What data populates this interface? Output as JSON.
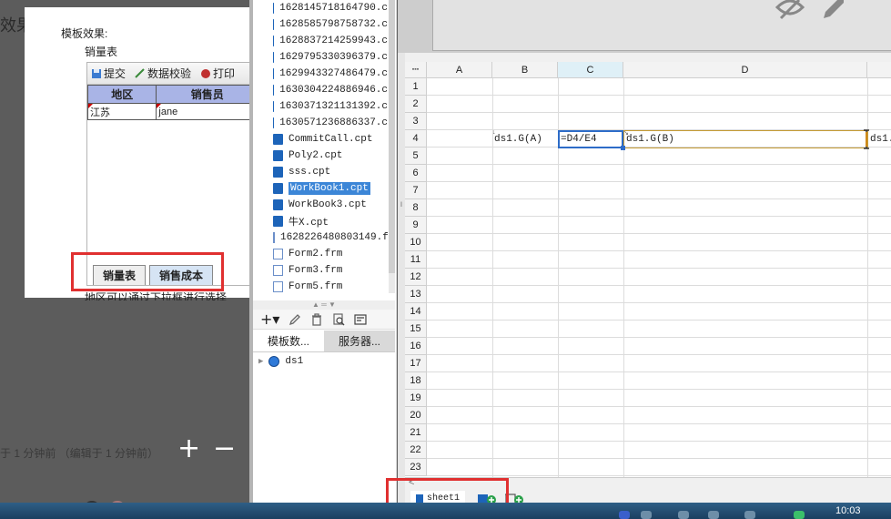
{
  "background": {
    "title_fragment": "效果",
    "status_text": "于 1 分钟前 （编辑于 1 分钟前）",
    "zoom_in": "+",
    "zoom_out": "−",
    "fragment_line": "地区可以通过下拉框进行选择"
  },
  "preview": {
    "caption": "模板效果:",
    "report_title": "销量表",
    "toolbar": {
      "submit_label": "提交",
      "validate_label": "数据校验",
      "print_label": "打印"
    },
    "table": {
      "headers": [
        "地区",
        "销售员"
      ],
      "rows": [
        [
          "江苏",
          "jane"
        ]
      ]
    },
    "sheet_tabs": [
      "销量表",
      "销售成本"
    ]
  },
  "designer": {
    "files": [
      {
        "name": "1628145718164790.c",
        "type": "cpt",
        "selected": false
      },
      {
        "name": "1628585798758732.c",
        "type": "cpt",
        "selected": false
      },
      {
        "name": "1628837214259943.c",
        "type": "cpt",
        "selected": false
      },
      {
        "name": "1629795330396379.c",
        "type": "cpt",
        "selected": false
      },
      {
        "name": "1629943327486479.c",
        "type": "cpt",
        "selected": false
      },
      {
        "name": "1630304224886946.c",
        "type": "cpt",
        "selected": false
      },
      {
        "name": "1630371321131392.c",
        "type": "cpt",
        "selected": false
      },
      {
        "name": "1630571236886337.c",
        "type": "cpt",
        "selected": false
      },
      {
        "name": "CommitCall.cpt",
        "type": "cpt",
        "selected": false
      },
      {
        "name": "Poly2.cpt",
        "type": "cpt",
        "selected": false
      },
      {
        "name": "sss.cpt",
        "type": "cpt",
        "selected": false
      },
      {
        "name": "WorkBook1.cpt",
        "type": "cpt",
        "selected": true
      },
      {
        "name": "WorkBook3.cpt",
        "type": "cpt",
        "selected": false
      },
      {
        "name": "牛X.cpt",
        "type": "cpt",
        "selected": false
      },
      {
        "name": "1628226480803149.f",
        "type": "frm",
        "selected": false
      },
      {
        "name": "Form2.frm",
        "type": "frm",
        "selected": false
      },
      {
        "name": "Form3.frm",
        "type": "frm",
        "selected": false
      },
      {
        "name": "Form5.frm",
        "type": "frm",
        "selected": false
      }
    ],
    "panel_tabs": [
      "模板数...",
      "服务器..."
    ],
    "dataset": "ds1",
    "add_label": "+▾"
  },
  "grid": {
    "columns": [
      "A",
      "B",
      "C",
      "D"
    ],
    "rows": [
      "1",
      "2",
      "3",
      "4",
      "5",
      "6",
      "7",
      "8",
      "9",
      "10",
      "11",
      "12",
      "13",
      "14",
      "15",
      "16",
      "17",
      "18",
      "19",
      "20",
      "21",
      "22",
      "23"
    ],
    "cells": {
      "B4": "ds1.G(A)",
      "C4": "=D4/E4",
      "D4": "ds1.G(B)",
      "E4": "ds1."
    },
    "selected_cell": "C4"
  },
  "sheet_bar": {
    "sheet_name": "sheet1",
    "scroll_left": "<"
  },
  "taskbar": {
    "clock": "10:03"
  },
  "colors": {
    "accent": "#3c86d7",
    "highlight_box": "#e03030",
    "preview_header": "#a9b4e6"
  }
}
